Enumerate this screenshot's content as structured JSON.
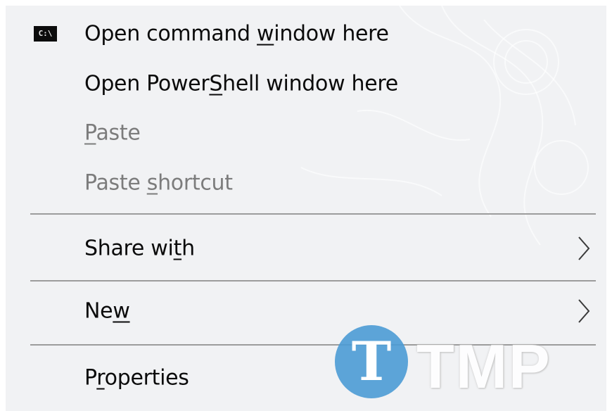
{
  "menu": {
    "items": [
      {
        "pre": "Open command ",
        "key": "w",
        "post": "indow here",
        "icon": "command-prompt-icon",
        "disabled": false,
        "submenu": false
      },
      {
        "pre": "Open Power",
        "key": "S",
        "post": "hell window here",
        "icon": "",
        "disabled": false,
        "submenu": false
      },
      {
        "pre": "",
        "key": "P",
        "post": "aste",
        "icon": "",
        "disabled": true,
        "submenu": false
      },
      {
        "pre": "Paste ",
        "key": "s",
        "post": "hortcut",
        "icon": "",
        "disabled": true,
        "submenu": false
      },
      {
        "pre": "Share wi",
        "key": "t",
        "post": "h",
        "icon": "chevron-right-icon",
        "disabled": false,
        "submenu": true
      },
      {
        "pre": "Ne",
        "key": "w",
        "post": "",
        "icon": "chevron-right-icon",
        "disabled": false,
        "submenu": true
      },
      {
        "pre": "P",
        "key": "r",
        "post": "operties",
        "icon": "",
        "disabled": false,
        "submenu": false
      }
    ],
    "cmd_icon_text": "C:\\"
  },
  "watermark": {
    "letter": "T",
    "text": "TMP"
  },
  "colors": {
    "menu_bg": "#f1f2f4",
    "text": "#0b0b0b",
    "disabled_text": "#7c7c7c",
    "separator": "#9c9c9c",
    "watermark_blue": "#4b9bd5"
  }
}
